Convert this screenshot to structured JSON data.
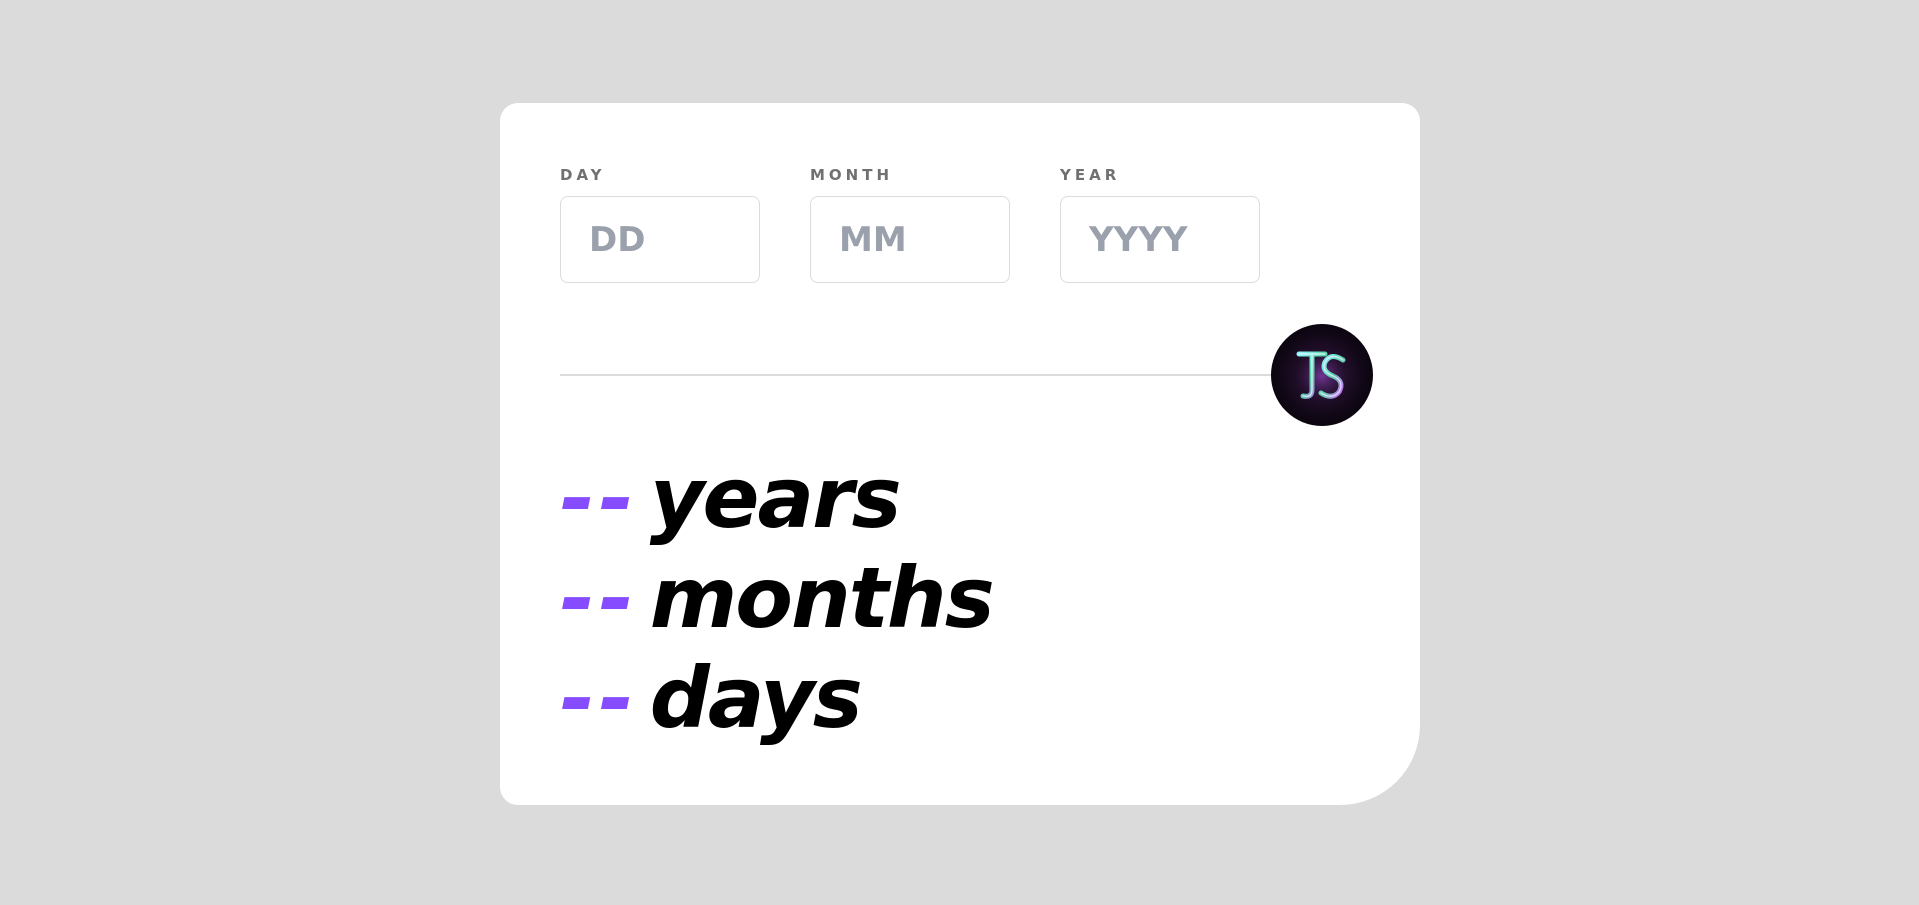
{
  "fields": {
    "day": {
      "label": "DAY",
      "placeholder": "DD",
      "value": ""
    },
    "month": {
      "label": "MONTH",
      "placeholder": "MM",
      "value": ""
    },
    "year": {
      "label": "YEAR",
      "placeholder": "YYYY",
      "value": ""
    }
  },
  "submit": {
    "icon": "js-logo-icon"
  },
  "results": [
    {
      "value": "--",
      "unit": "years"
    },
    {
      "value": "--",
      "unit": "months"
    },
    {
      "value": "--",
      "unit": "days"
    }
  ],
  "colors": {
    "background": "#dbdbdb",
    "card": "#ffffff",
    "accent": "#854dff",
    "label": "#716f6f",
    "placeholder": "#9aa0ac",
    "border": "#dcdcdc"
  }
}
